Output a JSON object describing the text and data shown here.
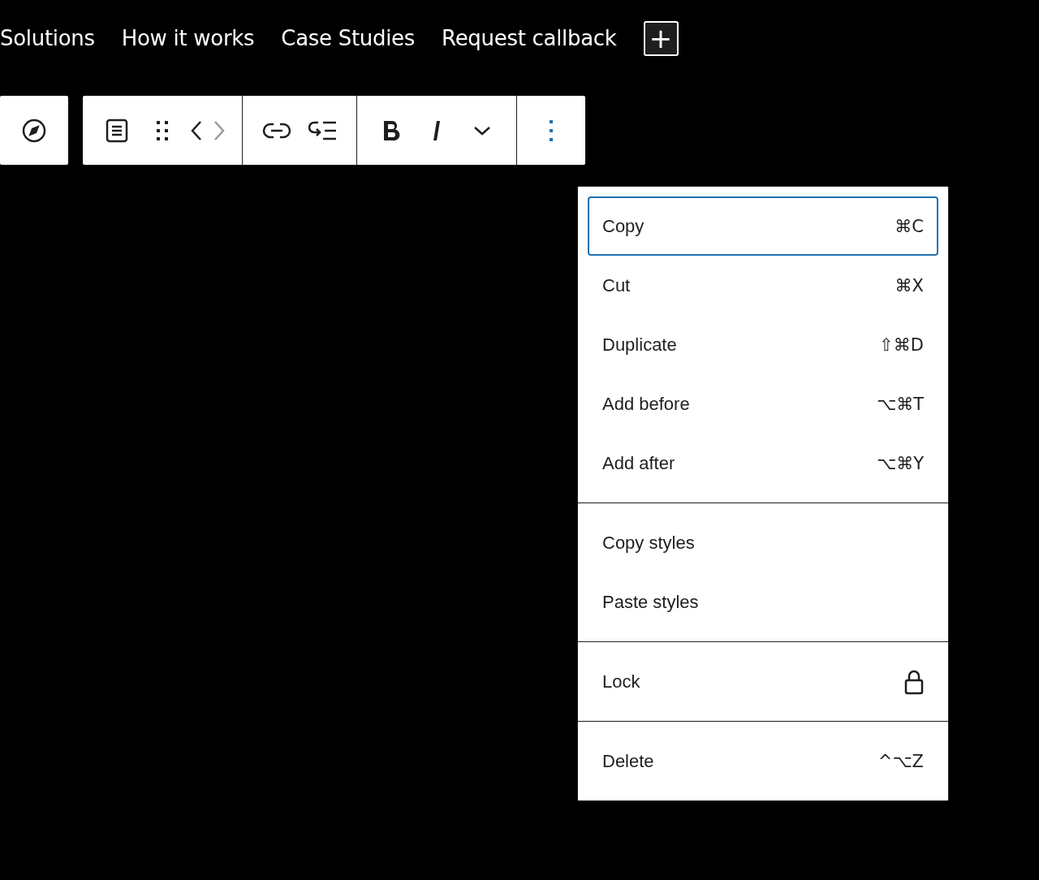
{
  "nav": {
    "links": [
      "Solutions",
      "How it works",
      "Case Studies",
      "Request callback"
    ],
    "add_button": "+"
  },
  "toolbar": {
    "groups": [
      {
        "buttons": [
          {
            "kind": "compass",
            "disabled": false,
            "pressed": false
          }
        ]
      },
      {
        "buttons": [
          {
            "kind": "paragraph",
            "disabled": false,
            "pressed": false
          },
          {
            "kind": "drag",
            "disabled": false,
            "pressed": false
          },
          {
            "kind": "move-left",
            "disabled": false,
            "pressed": false
          },
          {
            "kind": "move-right",
            "disabled": true,
            "pressed": false
          }
        ]
      },
      {
        "buttons": [
          {
            "kind": "link",
            "disabled": false,
            "pressed": false
          },
          {
            "kind": "list-loop",
            "disabled": false,
            "pressed": false
          }
        ]
      },
      {
        "buttons": [
          {
            "kind": "bold",
            "disabled": false,
            "pressed": false
          },
          {
            "kind": "italic",
            "disabled": false,
            "pressed": false
          },
          {
            "kind": "chevron",
            "disabled": false,
            "pressed": false
          }
        ]
      },
      {
        "buttons": [
          {
            "kind": "more",
            "disabled": false,
            "pressed": true
          }
        ]
      }
    ]
  },
  "menu": {
    "groups": [
      {
        "items": [
          {
            "kind": "shortcut",
            "label": "Copy",
            "shortcut": "⌘C",
            "focused": true
          },
          {
            "kind": "shortcut",
            "label": "Cut",
            "shortcut": "⌘X",
            "focused": false
          },
          {
            "kind": "shortcut",
            "label": "Duplicate",
            "shortcut": "⇧⌘D",
            "focused": false
          },
          {
            "kind": "shortcut",
            "label": "Add before",
            "shortcut": "⌥⌘T",
            "focused": false
          },
          {
            "kind": "shortcut",
            "label": "Add after",
            "shortcut": "⌥⌘Y",
            "focused": false
          }
        ]
      },
      {
        "items": [
          {
            "kind": "plain",
            "label": "Copy styles",
            "focused": false
          },
          {
            "kind": "plain",
            "label": "Paste styles",
            "focused": false
          }
        ]
      },
      {
        "items": [
          {
            "kind": "lock",
            "label": "Lock",
            "focused": false
          }
        ]
      },
      {
        "items": [
          {
            "kind": "shortcut",
            "label": "Delete",
            "shortcut": "^⌥Z",
            "focused": false
          }
        ]
      }
    ]
  }
}
